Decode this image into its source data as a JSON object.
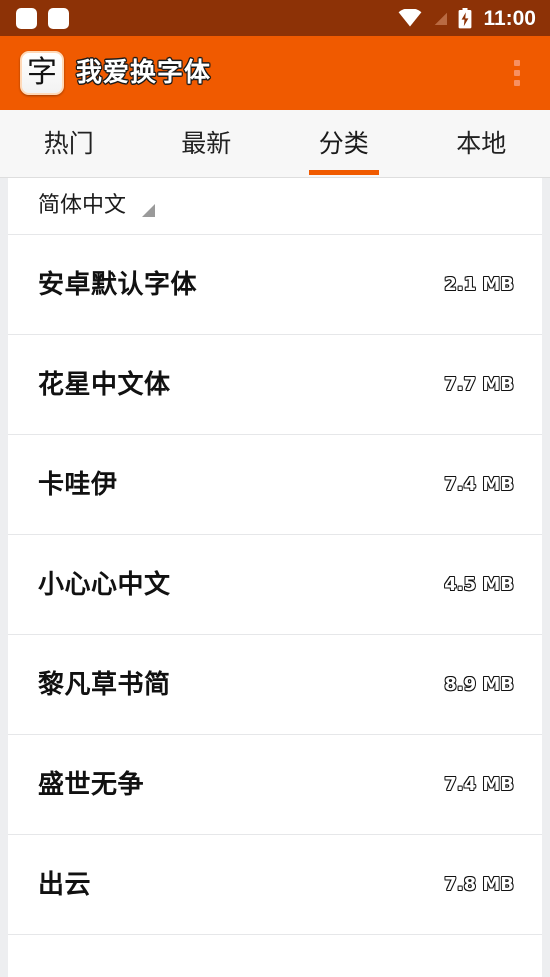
{
  "statusbar": {
    "background": "#8d3206",
    "clock": "11:00",
    "notification_icons": [
      "notification-square-1",
      "notification-square-2"
    ],
    "status_icons": [
      "wifi-icon",
      "signal-off-icon",
      "battery-charging-icon"
    ]
  },
  "appbar": {
    "background": "#f05a00",
    "app_icon_glyph": "字",
    "title": "我爱换字体",
    "overflow_menu": "overflow-menu-icon"
  },
  "tabs": {
    "accent": "#f05a00",
    "active_index": 2,
    "items": [
      {
        "label": "热门"
      },
      {
        "label": "最新"
      },
      {
        "label": "分类"
      },
      {
        "label": "本地"
      }
    ]
  },
  "filter": {
    "label": "简体中文",
    "caret": "dropdown-caret-icon"
  },
  "font_list": [
    {
      "name": "安卓默认字体",
      "size": "2.1 MB"
    },
    {
      "name": "花星中文体",
      "size": "7.7 MB"
    },
    {
      "name": "卡哇伊",
      "size": "7.4 MB"
    },
    {
      "name": "小心心中文",
      "size": "4.5 MB"
    },
    {
      "name": "黎凡草书简",
      "size": "8.9 MB"
    },
    {
      "name": "盛世无争",
      "size": "7.4 MB"
    },
    {
      "name": "出云",
      "size": "7.8 MB"
    }
  ]
}
